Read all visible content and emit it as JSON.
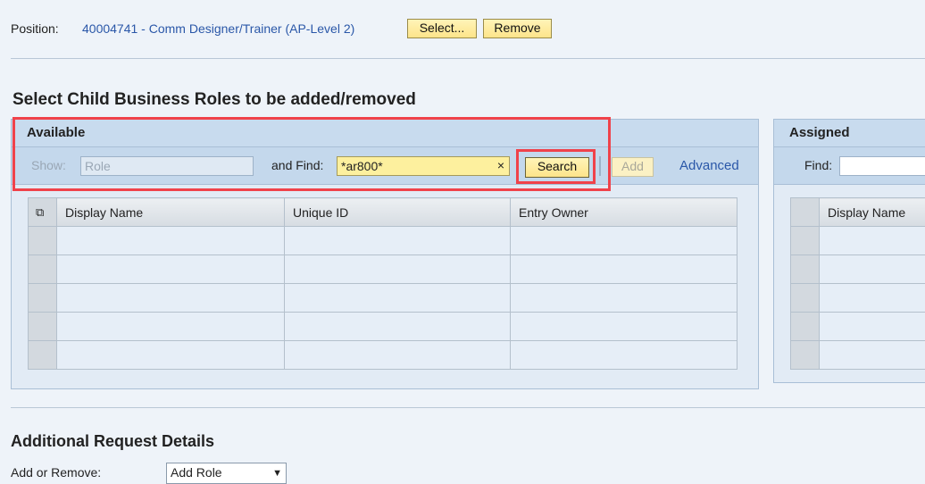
{
  "position": {
    "label": "Position:",
    "value": "40004741 - Comm Designer/Trainer (AP-Level 2)",
    "select_button": "Select...",
    "remove_button": "Remove"
  },
  "section_title": "Select Child Business Roles to be added/removed",
  "available": {
    "title": "Available",
    "show_label": "Show:",
    "show_value": "Role",
    "find_label": "and Find:",
    "find_value": "*ar800*",
    "clear_icon": "×",
    "search_button": "Search",
    "add_button": "Add",
    "advanced_link": "Advanced",
    "columns": [
      "Display Name",
      "Unique ID",
      "Entry Owner"
    ]
  },
  "assigned": {
    "title": "Assigned",
    "find_label": "Find:",
    "find_value": "",
    "columns": [
      "Display Name"
    ]
  },
  "additional": {
    "title": "Additional Request Details",
    "add_remove_label": "Add or Remove:",
    "add_remove_value": "Add Role"
  },
  "colors": {
    "highlight": "#f0424a",
    "link": "#2a57a8",
    "button": "#fde48a"
  }
}
